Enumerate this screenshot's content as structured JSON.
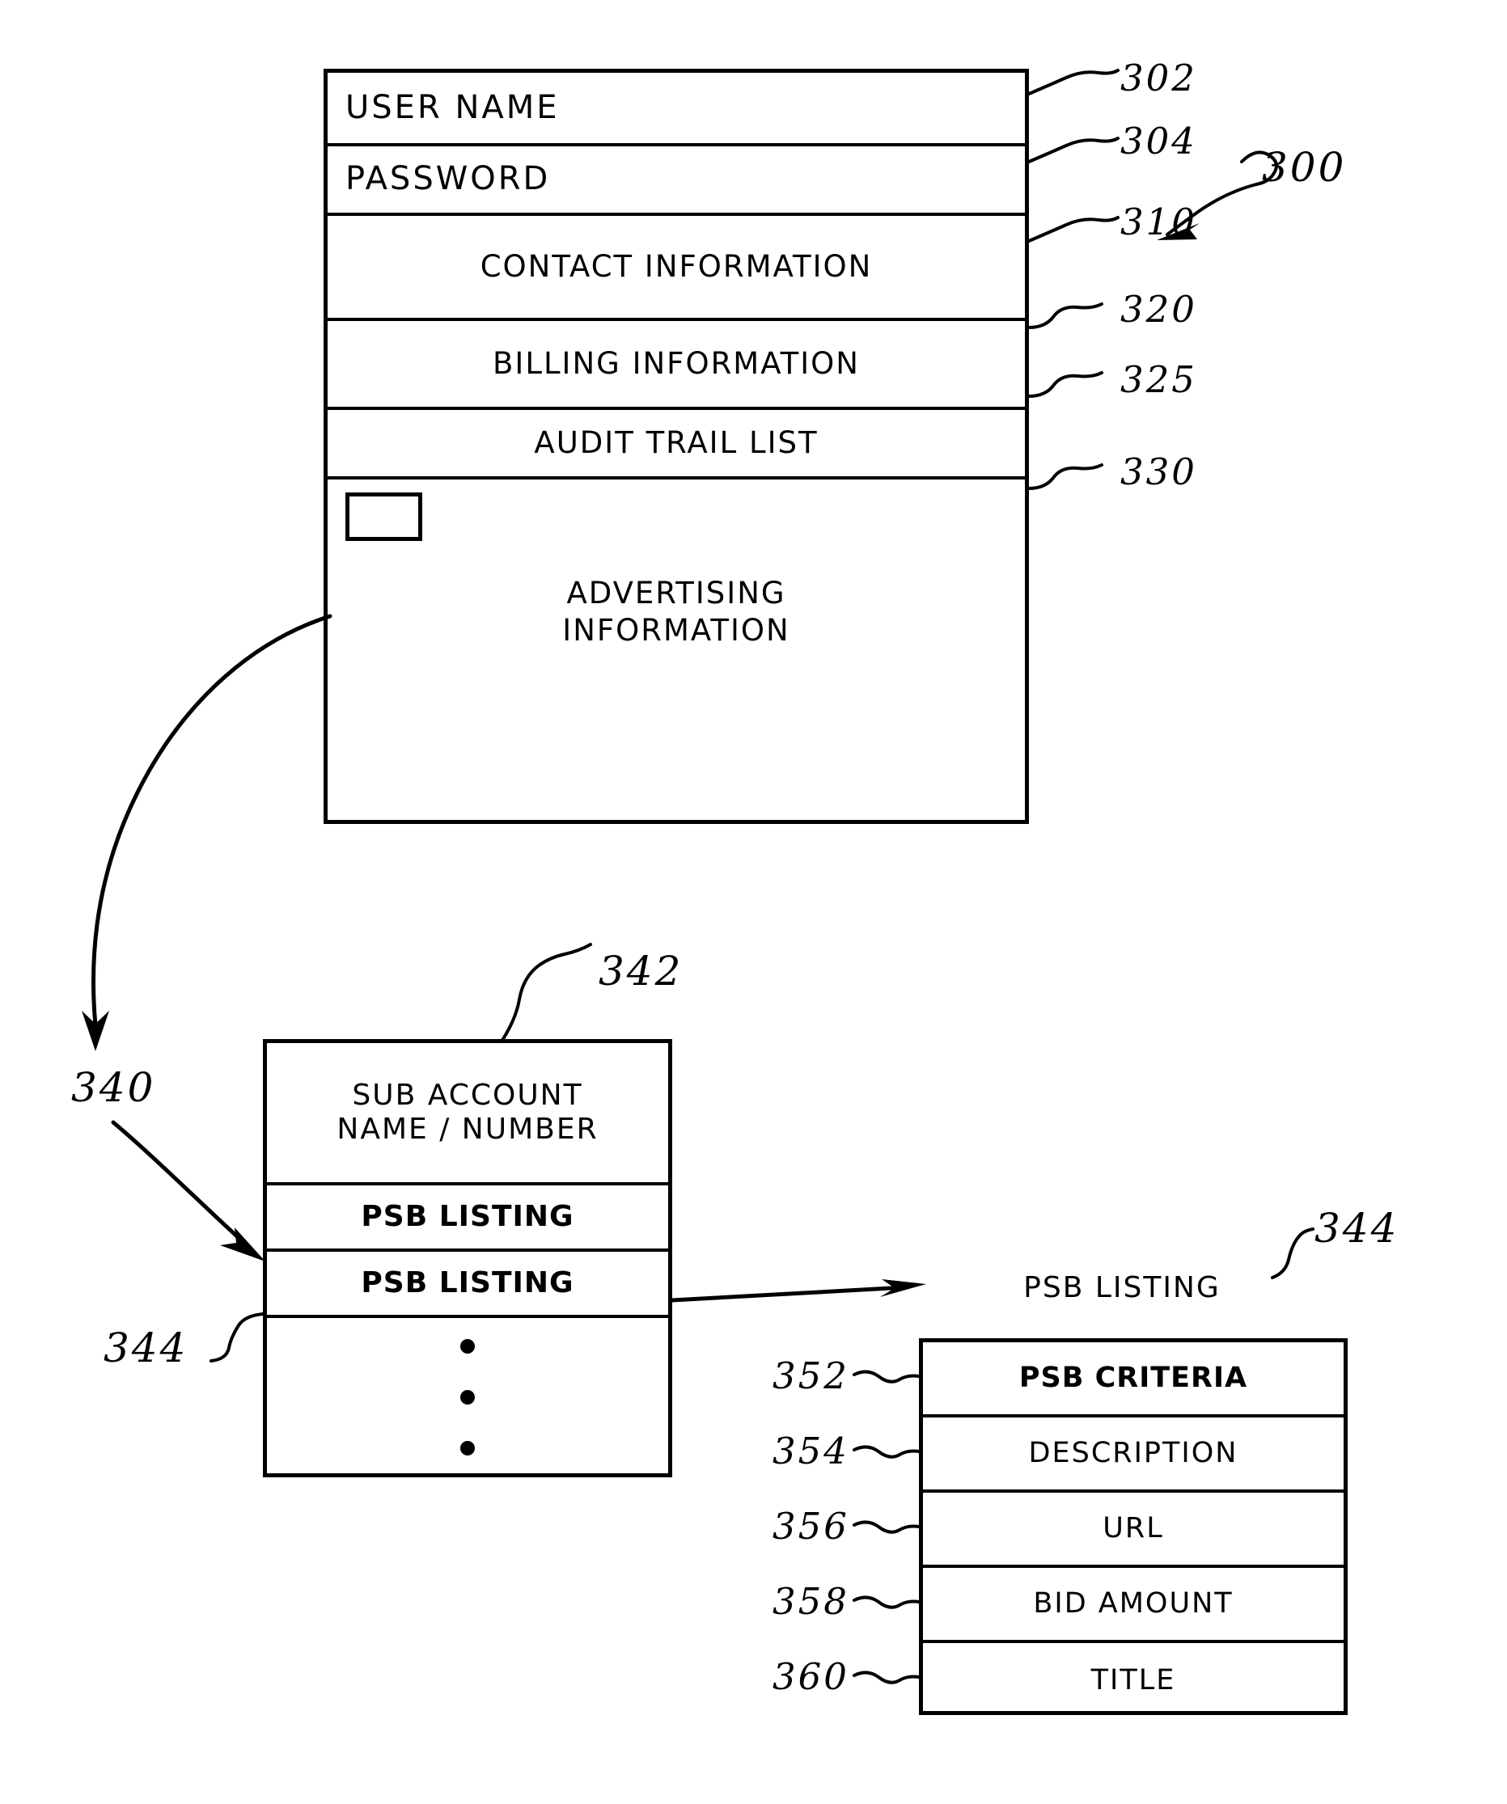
{
  "figure": {
    "type": "patent-block-diagram",
    "main_box": {
      "ref": "300",
      "rows": [
        {
          "label": "USER NAME",
          "ref": "302",
          "align": "left"
        },
        {
          "label": "PASSWORD",
          "ref": "304",
          "align": "left"
        },
        {
          "label": "CONTACT INFORMATION",
          "ref": "310",
          "align": "center"
        },
        {
          "label": "BILLING INFORMATION",
          "ref": "320",
          "align": "center"
        },
        {
          "label": "AUDIT TRAIL LIST",
          "ref": "325",
          "align": "center"
        },
        {
          "label": "ADVERTISING\nINFORMATION",
          "ref": "330",
          "align": "center"
        }
      ]
    },
    "sub_account_box": {
      "ref_box": "342",
      "ref_pointer": "340",
      "ref_row": "344",
      "rows": [
        {
          "label": "SUB ACCOUNT\nNAME / NUMBER",
          "bold": false
        },
        {
          "label": "PSB  LISTING",
          "bold": true
        },
        {
          "label": "PSB  LISTING",
          "bold": true
        },
        {
          "label": "",
          "bold": false,
          "dots": 3
        }
      ]
    },
    "psb_listing_box": {
      "caption": "PSB LISTING",
      "ref": "344",
      "rows": [
        {
          "label": "PSB CRITERIA",
          "ref": "352",
          "bold": true
        },
        {
          "label": "DESCRIPTION",
          "ref": "354",
          "bold": false
        },
        {
          "label": "URL",
          "ref": "356",
          "bold": false
        },
        {
          "label": "BID  AMOUNT",
          "ref": "358",
          "bold": false
        },
        {
          "label": "TITLE",
          "ref": "360",
          "bold": false
        }
      ]
    },
    "colors": {
      "ink": "#000000",
      "paper": "#ffffff"
    }
  }
}
